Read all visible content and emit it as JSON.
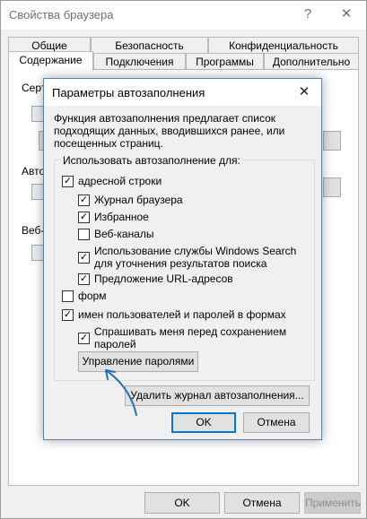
{
  "outer_window": {
    "title": "Свойства браузера",
    "tabs_top": [
      "Общие",
      "Безопасность",
      "Конфиденциальность"
    ],
    "tabs_bottom": [
      "Содержание",
      "Подключения",
      "Программы",
      "Дополнительно"
    ],
    "active_tab": "Содержание",
    "bg_labels": [
      "Серт",
      "Автоз",
      "Веб-к"
    ],
    "buttons": {
      "ok": "OK",
      "cancel": "Отмена",
      "apply": "Применить"
    }
  },
  "dialog": {
    "title": "Параметры автозаполнения",
    "description": "Функция автозаполнения предлагает список подходящих данных, вводившихся ранее, или посещенных страниц.",
    "group_label": "Использовать автозаполнение для:",
    "options": {
      "address_bar": {
        "label": "адресной строки",
        "checked": true
      },
      "history": {
        "label": "Журнал браузера",
        "checked": true
      },
      "favorites": {
        "label": "Избранное",
        "checked": true
      },
      "feeds": {
        "label": "Веб-каналы",
        "checked": false
      },
      "windows_search": {
        "label": "Использование службы Windows Search для уточнения результатов поиска",
        "checked": true
      },
      "url_suggest": {
        "label": "Предложение URL-адресов",
        "checked": true
      },
      "forms": {
        "label": "форм",
        "checked": false
      },
      "passwords": {
        "label": "имен пользователей и паролей в формах",
        "checked": true
      },
      "ask_save": {
        "label": "Спрашивать меня перед сохранением паролей",
        "checked": true
      }
    },
    "manage_passwords_button": "Управление паролями",
    "delete_history_button": "Удалить журнал автозаполнения...",
    "ok_button": "OK",
    "cancel_button": "Отмена",
    "accent_color": "#1e73b8"
  }
}
